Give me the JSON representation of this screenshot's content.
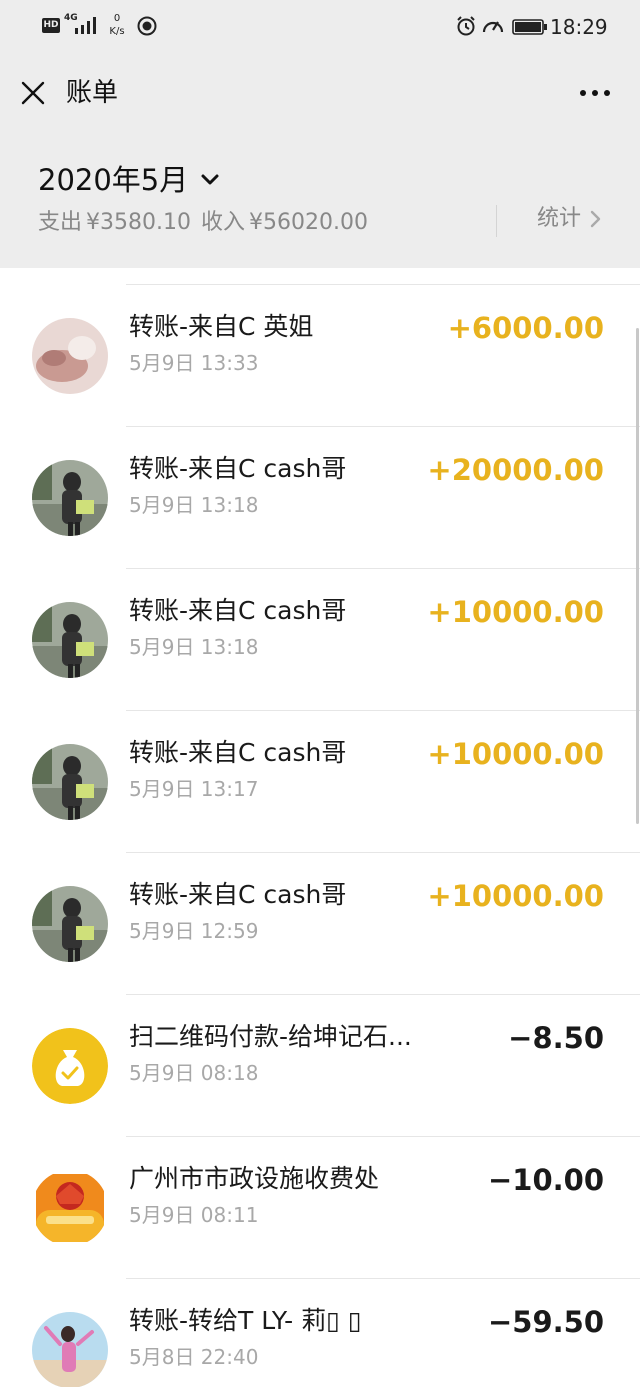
{
  "status_bar": {
    "hd_label": "HD",
    "network_label": "4G",
    "speed_value": "0",
    "speed_unit": "K/s",
    "time": "18:29"
  },
  "header": {
    "title": "账单",
    "close_icon": "close-icon",
    "more_icon": "more-icon"
  },
  "summary": {
    "month": "2020年5月",
    "expense_label": "支出",
    "expense_amount": "¥3580.10",
    "income_label": "收入",
    "income_amount": "¥56020.00",
    "stats_label": "统计"
  },
  "colors": {
    "income_amount": "#e8b21e",
    "expense_amount": "#1a1a1a",
    "background_gray": "#ededed",
    "secondary_text": "#a8a8a8",
    "pay_icon_yellow": "#f1c21b"
  },
  "transactions": [
    {
      "title": "转账-来自C 英姐",
      "time": "5月9日 13:33",
      "amount": "+6000.00",
      "type": "income",
      "avatar": "avatar-photo-pink"
    },
    {
      "title": "转账-来自C cash哥",
      "time": "5月9日 13:18",
      "amount": "+20000.00",
      "type": "income",
      "avatar": "avatar-photo-outdoor"
    },
    {
      "title": "转账-来自C cash哥",
      "time": "5月9日 13:18",
      "amount": "+10000.00",
      "type": "income",
      "avatar": "avatar-photo-outdoor"
    },
    {
      "title": "转账-来自C cash哥",
      "time": "5月9日 13:17",
      "amount": "+10000.00",
      "type": "income",
      "avatar": "avatar-photo-outdoor"
    },
    {
      "title": "转账-来自C cash哥",
      "time": "5月9日 12:59",
      "amount": "+10000.00",
      "type": "income",
      "avatar": "avatar-photo-outdoor"
    },
    {
      "title": "扫二维码付款-给坤记石...",
      "time": "5月9日 08:18",
      "amount": "−8.50",
      "type": "expense",
      "avatar": "money-bag-icon"
    },
    {
      "title": "广州市市政设施收费处",
      "time": "5月9日 08:11",
      "amount": "−10.00",
      "type": "expense",
      "avatar": "city-emblem-logo"
    },
    {
      "title": "转账-转给T LY- 莉▯ ▯",
      "time": "5月8日 22:40",
      "amount": "−59.50",
      "type": "expense",
      "avatar": "avatar-photo-beach"
    }
  ]
}
